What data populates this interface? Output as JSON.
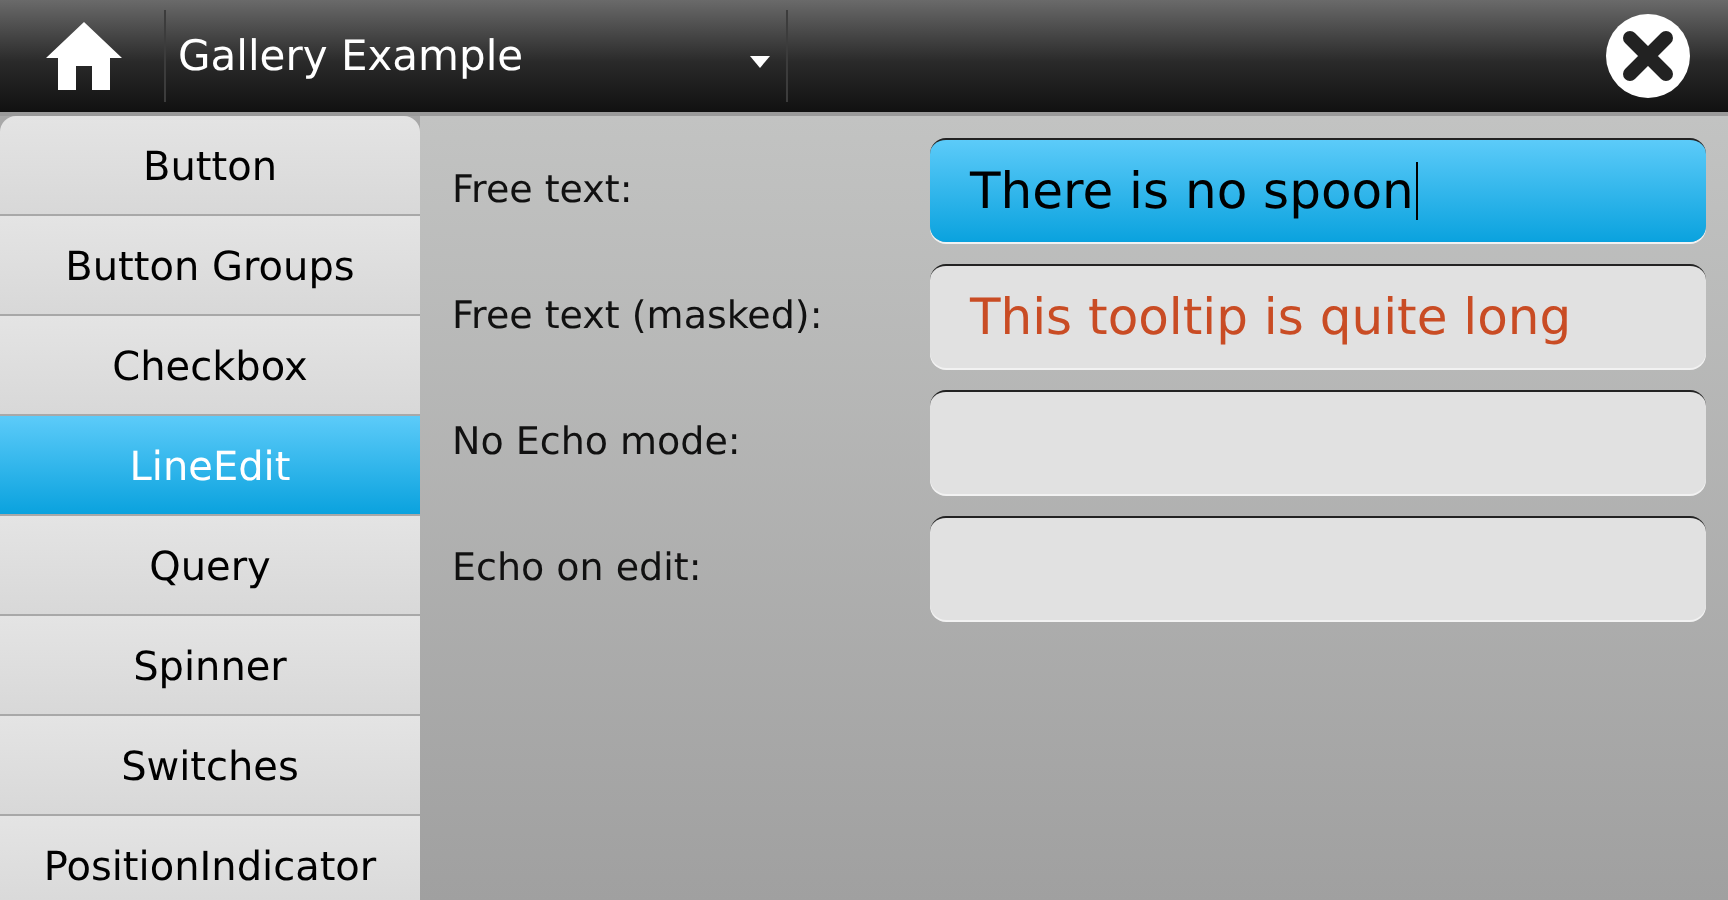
{
  "toolbar": {
    "title": "Gallery Example",
    "has_menu": true
  },
  "sidebar": {
    "items": [
      {
        "label": "Button",
        "selected": false
      },
      {
        "label": "Button Groups",
        "selected": false
      },
      {
        "label": "Checkbox",
        "selected": false
      },
      {
        "label": "LineEdit",
        "selected": true
      },
      {
        "label": "Query",
        "selected": false
      },
      {
        "label": "Spinner",
        "selected": false
      },
      {
        "label": "Switches",
        "selected": false
      },
      {
        "label": "PositionIndicator",
        "selected": false
      }
    ]
  },
  "form": {
    "rows": [
      {
        "label": "Free text:",
        "value": "There is no spoon",
        "focused": true
      },
      {
        "label": "Free text (masked):",
        "placeholder": "This tooltip is quite long",
        "focused": false
      },
      {
        "label": "No Echo mode:",
        "focused": false
      },
      {
        "label": "Echo on edit:",
        "focused": false
      }
    ]
  }
}
